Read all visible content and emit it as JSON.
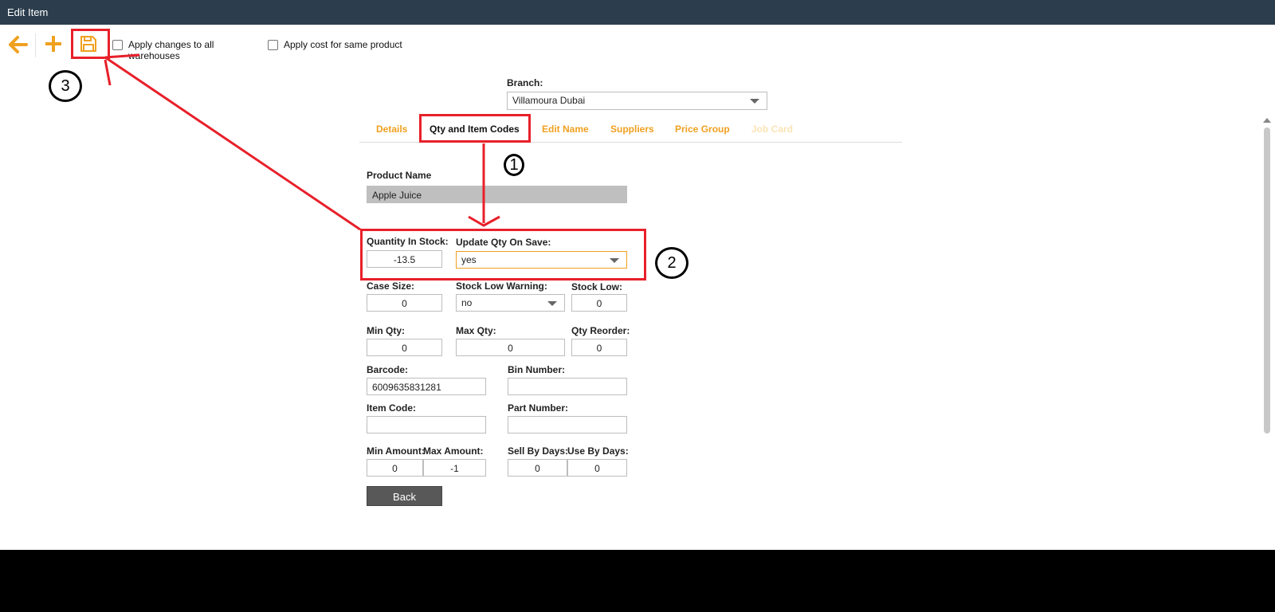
{
  "window": {
    "title": "Edit Item"
  },
  "toolbar": {
    "back_icon": "arrow-left-icon",
    "add_icon": "plus-icon",
    "save_icon": "floppy-save-icon",
    "apply_all_warehouses": {
      "label": "Apply changes to all warehouses",
      "checked": false
    },
    "apply_cost_same_product": {
      "label": "Apply cost for same product",
      "checked": false
    }
  },
  "branch": {
    "label": "Branch:",
    "value": "Villamoura Dubai"
  },
  "tabs": [
    {
      "label": "Details",
      "state": "normal"
    },
    {
      "label": "Qty and Item Codes",
      "state": "active"
    },
    {
      "label": "Edit Name",
      "state": "normal"
    },
    {
      "label": "Suppliers",
      "state": "normal"
    },
    {
      "label": "Price Group",
      "state": "normal"
    },
    {
      "label": "Job Card",
      "state": "disabled"
    }
  ],
  "form": {
    "product_name": {
      "label": "Product Name",
      "value": "Apple Juice"
    },
    "quantity_in_stock": {
      "label": "Quantity In Stock:",
      "value": "-13.5"
    },
    "update_qty_on_save": {
      "label": "Update Qty On Save:",
      "value": "yes"
    },
    "case_size": {
      "label": "Case Size:",
      "value": "0"
    },
    "stock_low_warning": {
      "label": "Stock Low Warning:",
      "value": "no"
    },
    "stock_low": {
      "label": "Stock Low:",
      "value": "0"
    },
    "min_qty": {
      "label": "Min Qty:",
      "value": "0"
    },
    "max_qty": {
      "label": "Max Qty:",
      "value": "0"
    },
    "qty_reorder": {
      "label": "Qty Reorder:",
      "value": "0"
    },
    "barcode": {
      "label": "Barcode:",
      "value": "6009635831281"
    },
    "bin_number": {
      "label": "Bin Number:",
      "value": ""
    },
    "item_code": {
      "label": "Item Code:",
      "value": ""
    },
    "part_number": {
      "label": "Part Number:",
      "value": ""
    },
    "min_amount": {
      "label": "Min Amount:",
      "value": "0"
    },
    "max_amount": {
      "label": "Max Amount:",
      "value": "-1"
    },
    "sell_by_days": {
      "label": "Sell By Days:",
      "value": "0"
    },
    "use_by_days": {
      "label": "Use By Days:",
      "value": "0"
    },
    "back_button": "Back"
  },
  "annotations": {
    "step1": "1",
    "step2": "2",
    "step3": "3",
    "color": "#e8202a"
  },
  "colors": {
    "titlebar": "#2c3e4d",
    "accent": "#f0a020",
    "button": "#585858"
  }
}
